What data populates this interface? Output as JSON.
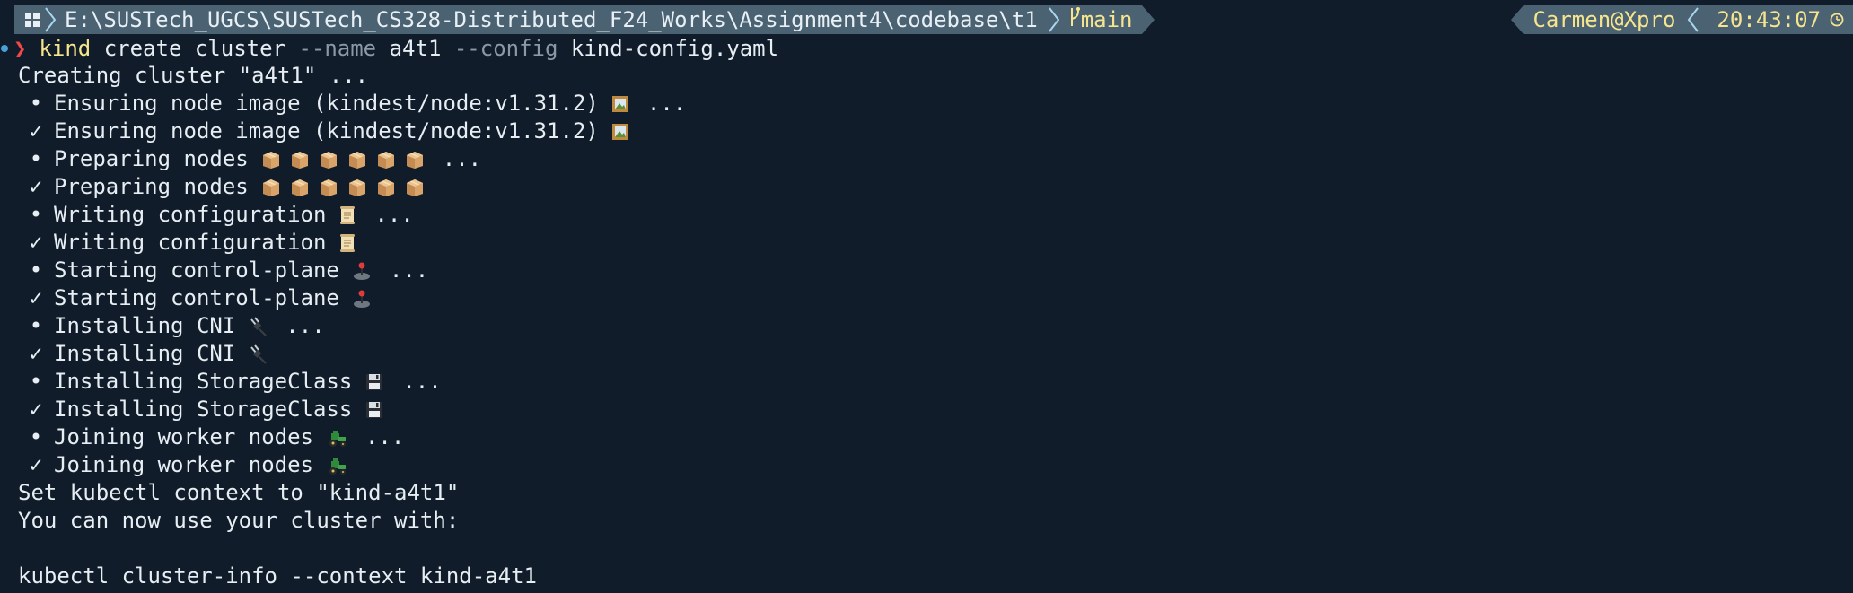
{
  "prompt": {
    "os_icon": "windows-icon",
    "path": "E:\\SUSTech_UGCS\\SUSTech_CS328-Distributed_F24_Works\\Assignment4\\codebase\\t1",
    "git_icon": "git-branch-icon",
    "branch": "main",
    "user": "Carmen@Xpro",
    "time": "20:43:07",
    "clock_icon": "clock-icon",
    "prompt_symbol": "❯",
    "colors": {
      "segment_bg": "#4a6272",
      "accent": "#f7e58d",
      "prompt_symbol": "#f04848",
      "background": "#101c2a"
    }
  },
  "command": {
    "program": "kind",
    "sub": " create cluster ",
    "flag1": "--name",
    "arg1": " a4t1 ",
    "flag2": "--config",
    "arg2": " kind-config.yaml"
  },
  "output": {
    "header": "Creating cluster \"a4t1\" ...",
    "steps": [
      {
        "bullet": "•",
        "text": "Ensuring node image (kindest/node:v1.31.2)",
        "icon": "picture-frame-icon",
        "suffix": "..."
      },
      {
        "bullet": "✓",
        "text": "Ensuring node image (kindest/node:v1.31.2)",
        "icon": "picture-frame-icon",
        "suffix": ""
      },
      {
        "bullet": "•",
        "text": "Preparing nodes",
        "icon": "package-box-icon",
        "suffix": "..."
      },
      {
        "bullet": "✓",
        "text": "Preparing nodes",
        "icon": "package-box-icon",
        "suffix": ""
      },
      {
        "bullet": "•",
        "text": "Writing configuration",
        "icon": "scroll-icon",
        "suffix": "..."
      },
      {
        "bullet": "✓",
        "text": "Writing configuration",
        "icon": "scroll-icon",
        "suffix": ""
      },
      {
        "bullet": "•",
        "text": "Starting control-plane",
        "icon": "joystick-icon",
        "suffix": "..."
      },
      {
        "bullet": "✓",
        "text": "Starting control-plane",
        "icon": "joystick-icon",
        "suffix": ""
      },
      {
        "bullet": "•",
        "text": "Installing CNI",
        "icon": "electric-plug-icon",
        "suffix": "..."
      },
      {
        "bullet": "✓",
        "text": "Installing CNI",
        "icon": "electric-plug-icon",
        "suffix": ""
      },
      {
        "bullet": "•",
        "text": "Installing StorageClass",
        "icon": "floppy-disk-icon",
        "suffix": "..."
      },
      {
        "bullet": "✓",
        "text": "Installing StorageClass",
        "icon": "floppy-disk-icon",
        "suffix": ""
      },
      {
        "bullet": "•",
        "text": "Joining worker nodes",
        "icon": "tractor-icon",
        "suffix": "..."
      },
      {
        "bullet": "✓",
        "text": "Joining worker nodes",
        "icon": "tractor-icon",
        "suffix": ""
      }
    ],
    "context_line": "Set kubectl context to \"kind-a4t1\"",
    "usage_line": "You can now use your cluster with:",
    "blank": "",
    "cluster_info_cmd": "kubectl cluster-info --context kind-a4t1"
  }
}
